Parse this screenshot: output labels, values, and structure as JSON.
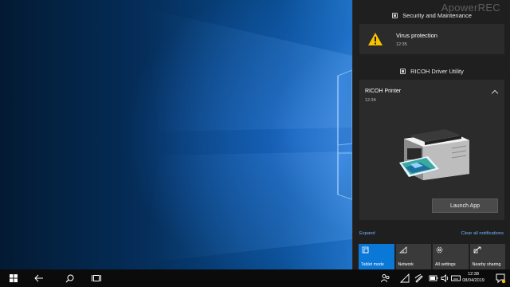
{
  "watermark": "ApowerREC",
  "security_group": {
    "header": "Security and Maintenance",
    "icon": "security-maintenance-icon",
    "notification": {
      "title": "Virus protection",
      "time": "12:35",
      "icon": "warning-icon"
    }
  },
  "ricoh_group": {
    "header": "RICOH Driver Utility",
    "icon": "app-icon",
    "notification": {
      "title": "RICOH Printer",
      "time": "12:34",
      "image": "printer-icon",
      "button_label": "Launch App"
    }
  },
  "links": {
    "expand": "Expand",
    "clear_all": "Clear all notifications"
  },
  "quick_actions": [
    {
      "label": "Tablet mode",
      "icon": "tablet-mode-icon",
      "active": true
    },
    {
      "label": "Network",
      "icon": "network-icon",
      "active": false
    },
    {
      "label": "All settings",
      "icon": "settings-icon",
      "active": false
    },
    {
      "label": "Nearby sharing",
      "icon": "nearby-sharing-icon",
      "active": false
    }
  ],
  "taskbar": {
    "time": "12:38",
    "date": "08/04/2019",
    "icons": [
      "windows-start-icon",
      "back-arrow-icon",
      "search-icon",
      "task-view-icon",
      "people-icon",
      "network-tray-icon",
      "pen-workspace-icon",
      "battery-icon",
      "volume-icon",
      "keyboard-icon",
      "notification-icon"
    ]
  },
  "colors": {
    "accent": "#0a78d7",
    "warning": "#f7c200",
    "link": "#6fb6ff",
    "action_center_bg": "#1f1f1f"
  }
}
